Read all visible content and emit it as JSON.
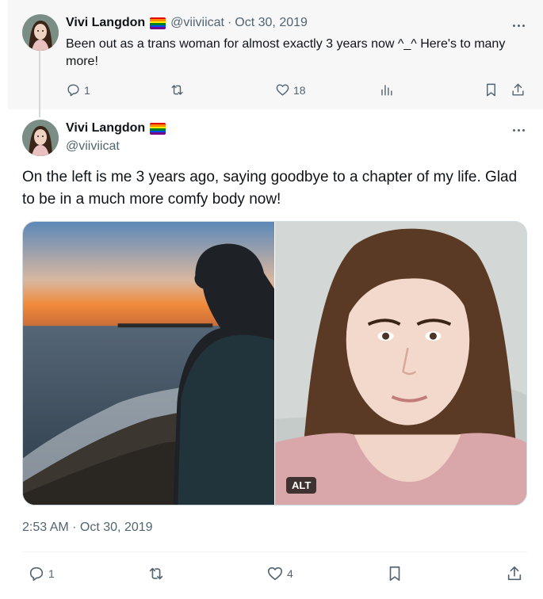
{
  "parent": {
    "author": "Vivi Langdon",
    "handle": "@viiviicat",
    "separator": "·",
    "date": "Oct 30, 2019",
    "text": "Been out as a trans woman for almost exactly 3 years now ^_^ Here's to many more!",
    "replies": "1",
    "retweets": "",
    "likes": "18",
    "views": ""
  },
  "main": {
    "author": "Vivi Langdon",
    "handle": "@viiviicat",
    "text": "On the left is me 3 years ago, saying goodbye to a chapter of my life. Glad to be in a much more comfy body now!",
    "media": {
      "left_image": "silhouette-at-beach-sunset",
      "right_image": "selfie-in-bed",
      "alt_label": "ALT"
    },
    "timestamp": "2:53 AM · Oct 30, 2019",
    "replies": "1",
    "retweets": "",
    "likes": "4"
  },
  "icons": [
    "more-icon",
    "reply-icon",
    "retweet-icon",
    "like-icon",
    "views-icon",
    "bookmark-icon",
    "share-icon",
    "rainbow-flag-icon"
  ],
  "colors": {
    "text": "#0f1419",
    "secondary": "#536471",
    "parent_background": "#f7f7f7",
    "thread_line": "#cfd9de",
    "flag": [
      "#e40303",
      "#ff8c00",
      "#ffed00",
      "#008026",
      "#004dff",
      "#750787"
    ]
  }
}
